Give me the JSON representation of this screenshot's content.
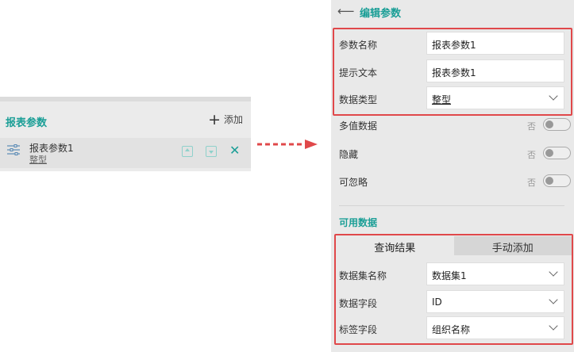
{
  "left_panel": {
    "title": "报表参数",
    "add_label": "添加",
    "param": {
      "name": "报表参数1",
      "type": "整型"
    }
  },
  "right_panel": {
    "back_icon": "arrow-left-icon",
    "title": "编辑参数",
    "fields": {
      "name": {
        "label": "参数名称",
        "value": "报表参数1"
      },
      "prompt": {
        "label": "提示文本",
        "value": "报表参数1"
      },
      "type": {
        "label": "数据类型",
        "value": "整型"
      }
    },
    "toggles": {
      "multi": {
        "label": "多值数据",
        "state": "否"
      },
      "hidden": {
        "label": "隐藏",
        "state": "否"
      },
      "ignorable": {
        "label": "可忽略",
        "state": "否"
      }
    },
    "available_data": {
      "title": "可用数据",
      "tabs": [
        "查询结果",
        "手动添加"
      ],
      "dataset": {
        "label": "数据集名称",
        "value": "数据集1"
      },
      "data_field": {
        "label": "数据字段",
        "value": "ID"
      },
      "label_field": {
        "label": "标签字段",
        "value": "组织名称"
      }
    }
  },
  "colors": {
    "accent": "#1a9e96",
    "highlight": "#e0484a"
  }
}
